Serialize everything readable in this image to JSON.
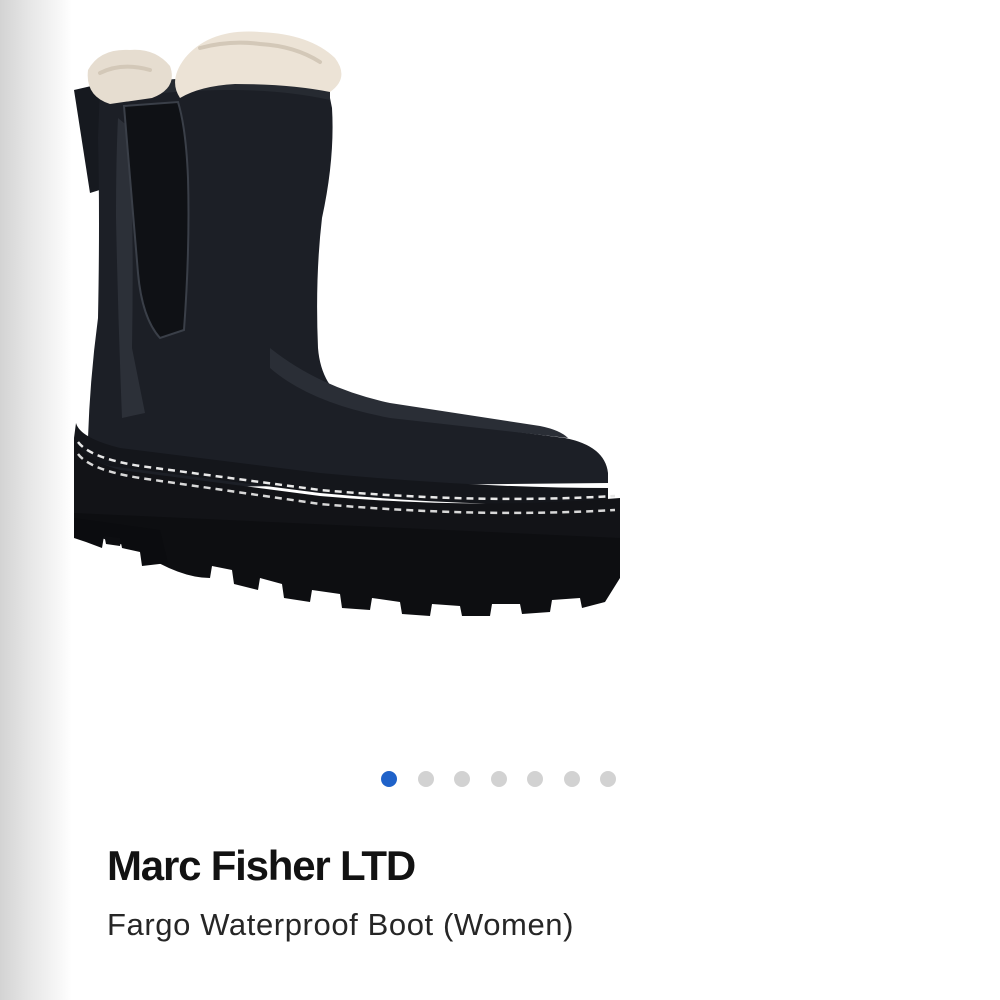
{
  "product": {
    "brand": "Marc Fisher LTD",
    "name": "Fargo Waterproof Boot (Women)"
  },
  "carousel": {
    "total": 7,
    "active_index": 0,
    "active_color": "#1f62c9",
    "inactive_color": "#d2d2d2"
  },
  "image": {
    "subject": "boot-image"
  }
}
